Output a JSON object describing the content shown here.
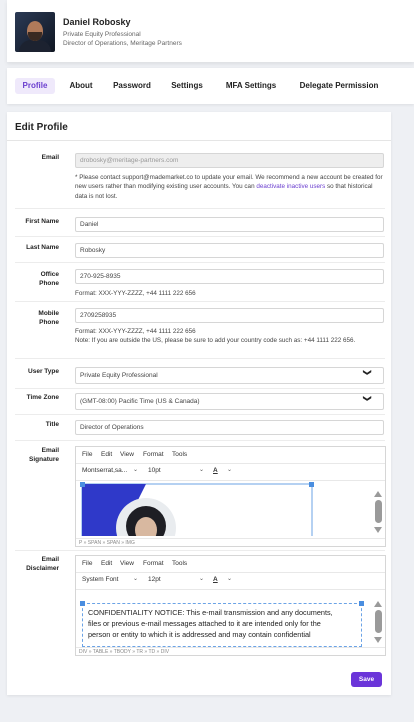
{
  "user": {
    "name": "Daniel Robosky",
    "title": "Private Equity Professional",
    "role": "Director of Operations, Meritage Partners"
  },
  "tabs": [
    {
      "label": "Profile",
      "active": true
    },
    {
      "label": "About"
    },
    {
      "label": "Password"
    },
    {
      "label": "Settings"
    },
    {
      "label": "MFA Settings"
    },
    {
      "label": "Delegate Permission"
    }
  ],
  "form": {
    "title": "Edit Profile",
    "email": {
      "label": "Email",
      "value": "drobosky@meritage-partners.com",
      "note_before": "* Please contact support@mademarket.co to update your email. We recommend a new account be created for new users rather than modifying existing user accounts. You can",
      "note_link": "deactivate inactive users",
      "note_after": "so that historical data is not lost."
    },
    "first_name": {
      "label": "First Name",
      "value": "Daniel"
    },
    "last_name": {
      "label": "Last Name",
      "value": "Robosky"
    },
    "office_phone": {
      "label_1": "Office",
      "label_2": "Phone",
      "value": "270-925-8935",
      "format": "Format: XXX-YYY-ZZZZ, +44 1111 222 656"
    },
    "mobile_phone": {
      "label_1": "Mobile",
      "label_2": "Phone",
      "value": "2709258935",
      "format": "Format: XXX-YYY-ZZZZ, +44 1111 222 656",
      "note": "Note: If you are outside the US, please be sure to add your country code such as: +44 1111 222 656."
    },
    "user_type": {
      "label": "User Type",
      "value": "Private Equity Professional"
    },
    "time_zone": {
      "label": "Time Zone",
      "value": "(GMT-08:00) Pacific Time (US & Canada)"
    },
    "title_field": {
      "label": "Title",
      "value": "Director of Operations"
    },
    "signature": {
      "label_1": "Email",
      "label_2": "Signature",
      "menu": [
        "File",
        "Edit",
        "View",
        "Format",
        "Tools"
      ],
      "font": "Montserrat,sa...",
      "size": "10pt",
      "color_btn": "A",
      "path": "P » SPAN » SPAN » IMG"
    },
    "disclaimer": {
      "label_1": "Email",
      "label_2": "Disclaimer",
      "menu": [
        "File",
        "Edit",
        "View",
        "Format",
        "Tools"
      ],
      "font": "System Font",
      "size": "12pt",
      "color_btn": "A",
      "text_1": "CONFIDENTIALITY NOTICE: This e-mail transmission and any documents,",
      "text_2": "files or previous e-mail messages attached to it are intended only for the",
      "text_3": "person or entity to which it is addressed and may contain confidential",
      "path": "DIV » TABLE » TBODY » TR » TD » DIV"
    },
    "save_label": "Save"
  },
  "colors": {
    "accent": "#6b35d9",
    "active_tab_bg": "#efe9fb",
    "image_blue": "#2f39c9"
  },
  "icons": {
    "select_arrow": "chevron-down-icon",
    "scroll_up": "scroll-up-icon",
    "scroll_down": "scroll-down-icon"
  }
}
